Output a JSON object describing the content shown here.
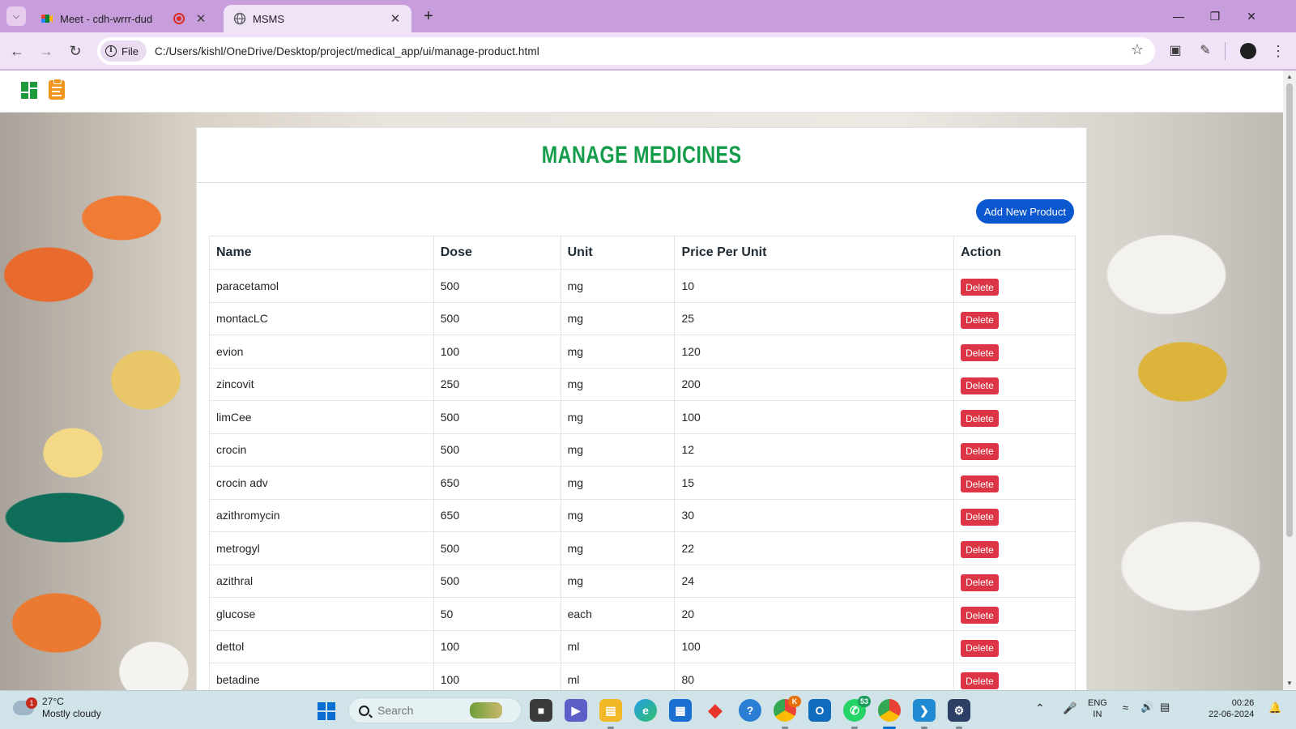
{
  "browser": {
    "tabs": [
      {
        "title": "Meet - cdh-wrrr-dud",
        "favicon": "google-meet-icon",
        "active": false,
        "recording": true
      },
      {
        "title": "MSMS",
        "favicon": "globe-icon",
        "active": true
      }
    ],
    "address": {
      "scheme_chip": "File",
      "url": "C:/Users/kishl/OneDrive/Desktop/project/medical_app/ui/manage-product.html"
    }
  },
  "page": {
    "title": "MANAGE MEDICINES",
    "add_button": "Add New Product",
    "table": {
      "headers": [
        "Name",
        "Dose",
        "Unit",
        "Price Per Unit",
        "Action"
      ],
      "rows": [
        {
          "name": "paracetamol",
          "dose": "500",
          "unit": "mg",
          "price": "10",
          "action": "Delete"
        },
        {
          "name": "montacLC",
          "dose": "500",
          "unit": "mg",
          "price": "25",
          "action": "Delete"
        },
        {
          "name": "evion",
          "dose": "100",
          "unit": "mg",
          "price": "120",
          "action": "Delete"
        },
        {
          "name": "zincovit",
          "dose": "250",
          "unit": "mg",
          "price": "200",
          "action": "Delete"
        },
        {
          "name": "limCee",
          "dose": "500",
          "unit": "mg",
          "price": "100",
          "action": "Delete"
        },
        {
          "name": "crocin",
          "dose": "500",
          "unit": "mg",
          "price": "12",
          "action": "Delete"
        },
        {
          "name": "crocin adv",
          "dose": "650",
          "unit": "mg",
          "price": "15",
          "action": "Delete"
        },
        {
          "name": "azithromycin",
          "dose": "650",
          "unit": "mg",
          "price": "30",
          "action": "Delete"
        },
        {
          "name": "metrogyl",
          "dose": "500",
          "unit": "mg",
          "price": "22",
          "action": "Delete"
        },
        {
          "name": "azithral",
          "dose": "500",
          "unit": "mg",
          "price": "24",
          "action": "Delete"
        },
        {
          "name": "glucose",
          "dose": "50",
          "unit": "each",
          "price": "20",
          "action": "Delete"
        },
        {
          "name": "dettol",
          "dose": "100",
          "unit": "ml",
          "price": "100",
          "action": "Delete"
        },
        {
          "name": "betadine",
          "dose": "100",
          "unit": "ml",
          "price": "80",
          "action": "Delete"
        }
      ]
    },
    "colors": {
      "title": "#149c4a",
      "add_button": "#0b57d0",
      "delete_button": "#dc3545"
    }
  },
  "taskbar": {
    "weather": {
      "temp": "27°C",
      "condition": "Mostly cloudy",
      "badge": "1"
    },
    "search_placeholder": "Search",
    "apps": [
      "task-view",
      "teams-meet",
      "file-explorer",
      "edge",
      "microsoft-store",
      "app-diamond",
      "help",
      "chrome-profile",
      "outlook-new",
      "whatsapp",
      "chrome",
      "vscode",
      "app-x"
    ],
    "whatsapp_badge": "53",
    "chrome_profile_badge": "K",
    "lang": {
      "line1": "ENG",
      "line2": "IN"
    },
    "time": "00:26",
    "date": "22-06-2024"
  }
}
